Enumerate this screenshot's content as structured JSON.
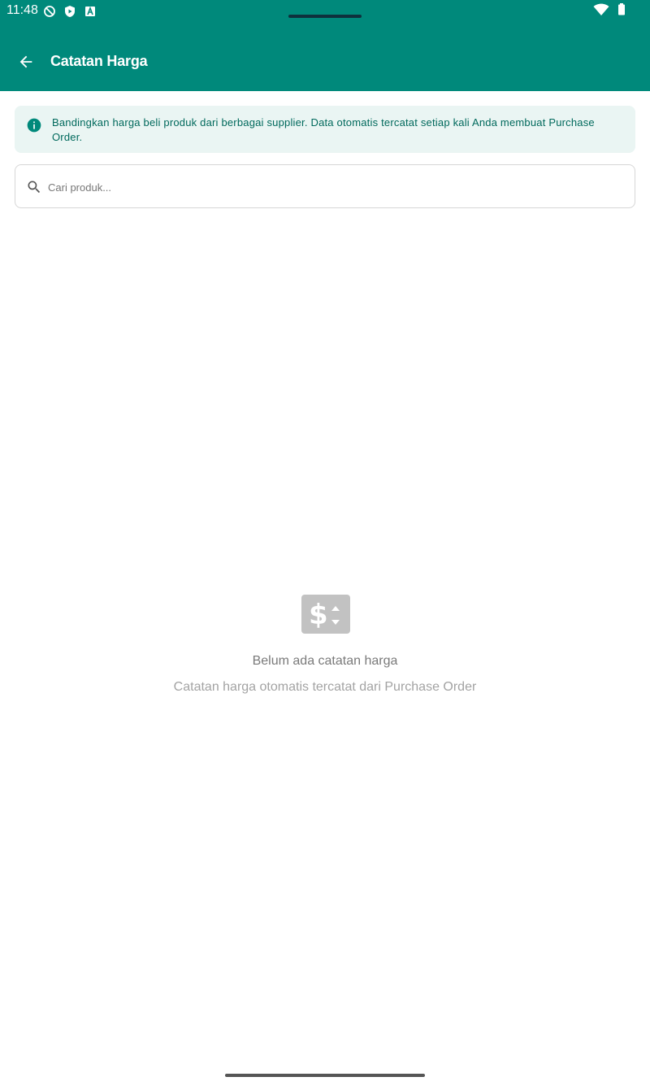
{
  "status_bar": {
    "time": "11:48",
    "left_icons": [
      "shield-off-icon",
      "play-protect-icon",
      "font-icon"
    ],
    "right_icons": [
      "wifi-icon",
      "battery-icon"
    ]
  },
  "app_bar": {
    "title": "Catatan Harga",
    "back_icon": "arrow-back-icon",
    "color": "#00897b"
  },
  "info_banner": {
    "icon": "info-icon",
    "text": "Bandingkan harga beli produk dari berbagai supplier. Data otomatis tercatat setiap kali Anda membuat Purchase Order.",
    "background": "#eaf5f3",
    "text_color": "#00695c"
  },
  "search": {
    "icon": "search-icon",
    "placeholder": "Cari produk...",
    "value": ""
  },
  "empty_state": {
    "icon": "price-change-icon",
    "title": "Belum ada catatan harga",
    "subtitle": "Catatan harga otomatis tercatat dari Purchase Order"
  }
}
